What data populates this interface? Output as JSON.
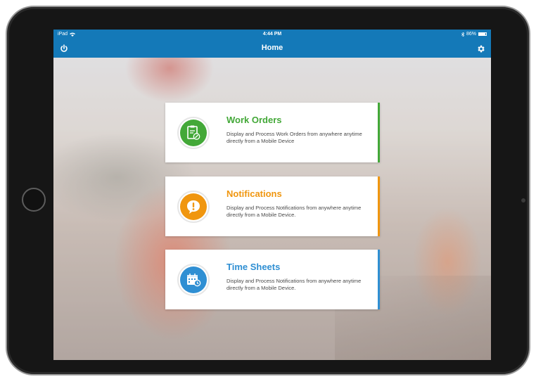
{
  "status_bar": {
    "device": "iPad",
    "time": "4:44 PM",
    "battery": "86%"
  },
  "nav": {
    "title": "Home",
    "power_icon": "power-icon",
    "settings_icon": "gear-icon",
    "bar_color": "#1479b8"
  },
  "cards": [
    {
      "title": "Work Orders",
      "description": "Display and Process Work Orders from anywhere anytime directly from a Mobile Device",
      "color": "#43a838",
      "icon": "clipboard-icon"
    },
    {
      "title": "Notifications",
      "description": "Display and Process Notifications from anywhere anytime directly from a Mobile Device.",
      "color": "#f0960f",
      "icon": "alert-bubble-icon"
    },
    {
      "title": "Time Sheets",
      "description": "Display and Process Notifications from anywhere anytime directly from a Mobile Device.",
      "color": "#2f8fd3",
      "icon": "calendar-icon"
    }
  ]
}
